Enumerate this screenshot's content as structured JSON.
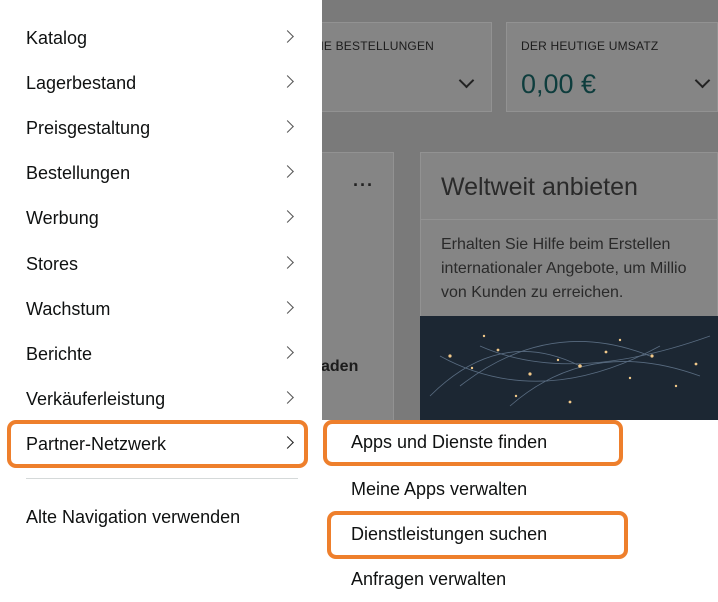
{
  "background": {
    "open_orders_label": "NE BESTELLUNGEN",
    "todays_revenue_label": "DER HEUTIGE UMSATZ",
    "todays_revenue_value": "0,00 €",
    "more_dots": "···",
    "global_card": {
      "title": "Weltweit anbieten",
      "description": "Erhalten Sie Hilfe beim Erstellen internationaler Angebote, um Millio von Kunden zu erreichen."
    },
    "partial_text": "aden"
  },
  "nav": {
    "items": [
      {
        "label": "Katalog"
      },
      {
        "label": "Lagerbestand"
      },
      {
        "label": "Preisgestaltung"
      },
      {
        "label": "Bestellungen"
      },
      {
        "label": "Werbung"
      },
      {
        "label": "Stores"
      },
      {
        "label": "Wachstum"
      },
      {
        "label": "Berichte"
      },
      {
        "label": "Verkäuferleistung"
      },
      {
        "label": "Partner-Netzwerk"
      }
    ],
    "old_navigation_label": "Alte Navigation verwenden"
  },
  "submenu": {
    "items": [
      {
        "label": "Apps und Dienste finden"
      },
      {
        "label": "Meine Apps verwalten"
      },
      {
        "label": "Dienstleistungen suchen"
      },
      {
        "label": "Anfragen verwalten"
      }
    ]
  },
  "colors": {
    "highlight": "#ee7f2c",
    "overlay": "#7a7a7a",
    "panel": "#ffffff"
  }
}
